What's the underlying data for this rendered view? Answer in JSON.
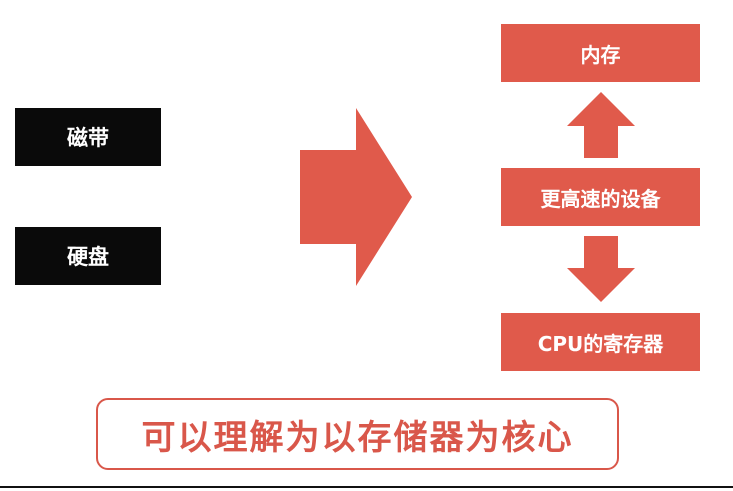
{
  "left_boxes": {
    "tape": "磁带",
    "disk": "硬盘"
  },
  "right_boxes": {
    "memory": "内存",
    "faster_device": "更高速的设备",
    "cpu_registers": "CPU的寄存器"
  },
  "banner": {
    "text": "可以理解为以存储器为核心"
  },
  "colors": {
    "accent_red": "#e05a4b",
    "dark_box": "#0a0a0a",
    "banner_border": "#d9574a",
    "background": "#ffffff"
  }
}
